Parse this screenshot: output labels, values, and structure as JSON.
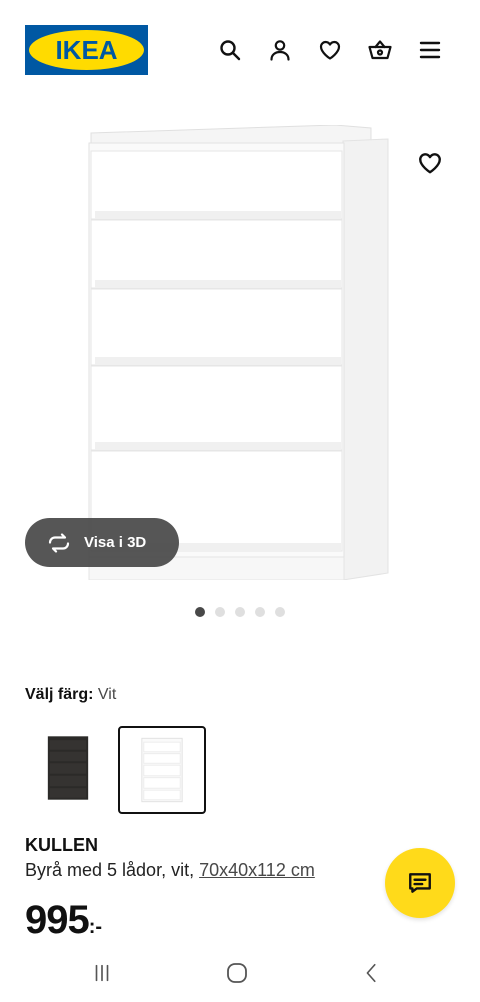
{
  "header": {
    "logo_text": "IKEA",
    "icons": [
      "search-icon",
      "account-icon",
      "favourites-icon",
      "cart-icon",
      "menu-icon"
    ]
  },
  "product_image": {
    "view_3d_label": "Visa i 3D",
    "carousel_total": 5,
    "carousel_active": 1
  },
  "color_picker": {
    "label": "Välj färg:",
    "selected": "Vit",
    "options": [
      {
        "name": "black-brown",
        "color": "#2b2a28"
      },
      {
        "name": "white",
        "color": "#ffffff"
      }
    ]
  },
  "product": {
    "name": "KULLEN",
    "description": "Byrå med 5 lådor, vit,",
    "size": "70x40x112 cm",
    "price": "995",
    "price_suffix": ":-"
  },
  "colors": {
    "ikea_blue": "#0058a3",
    "ikea_yellow": "#ffdb00",
    "chat_yellow": "#ffda1a",
    "text": "#111111"
  }
}
